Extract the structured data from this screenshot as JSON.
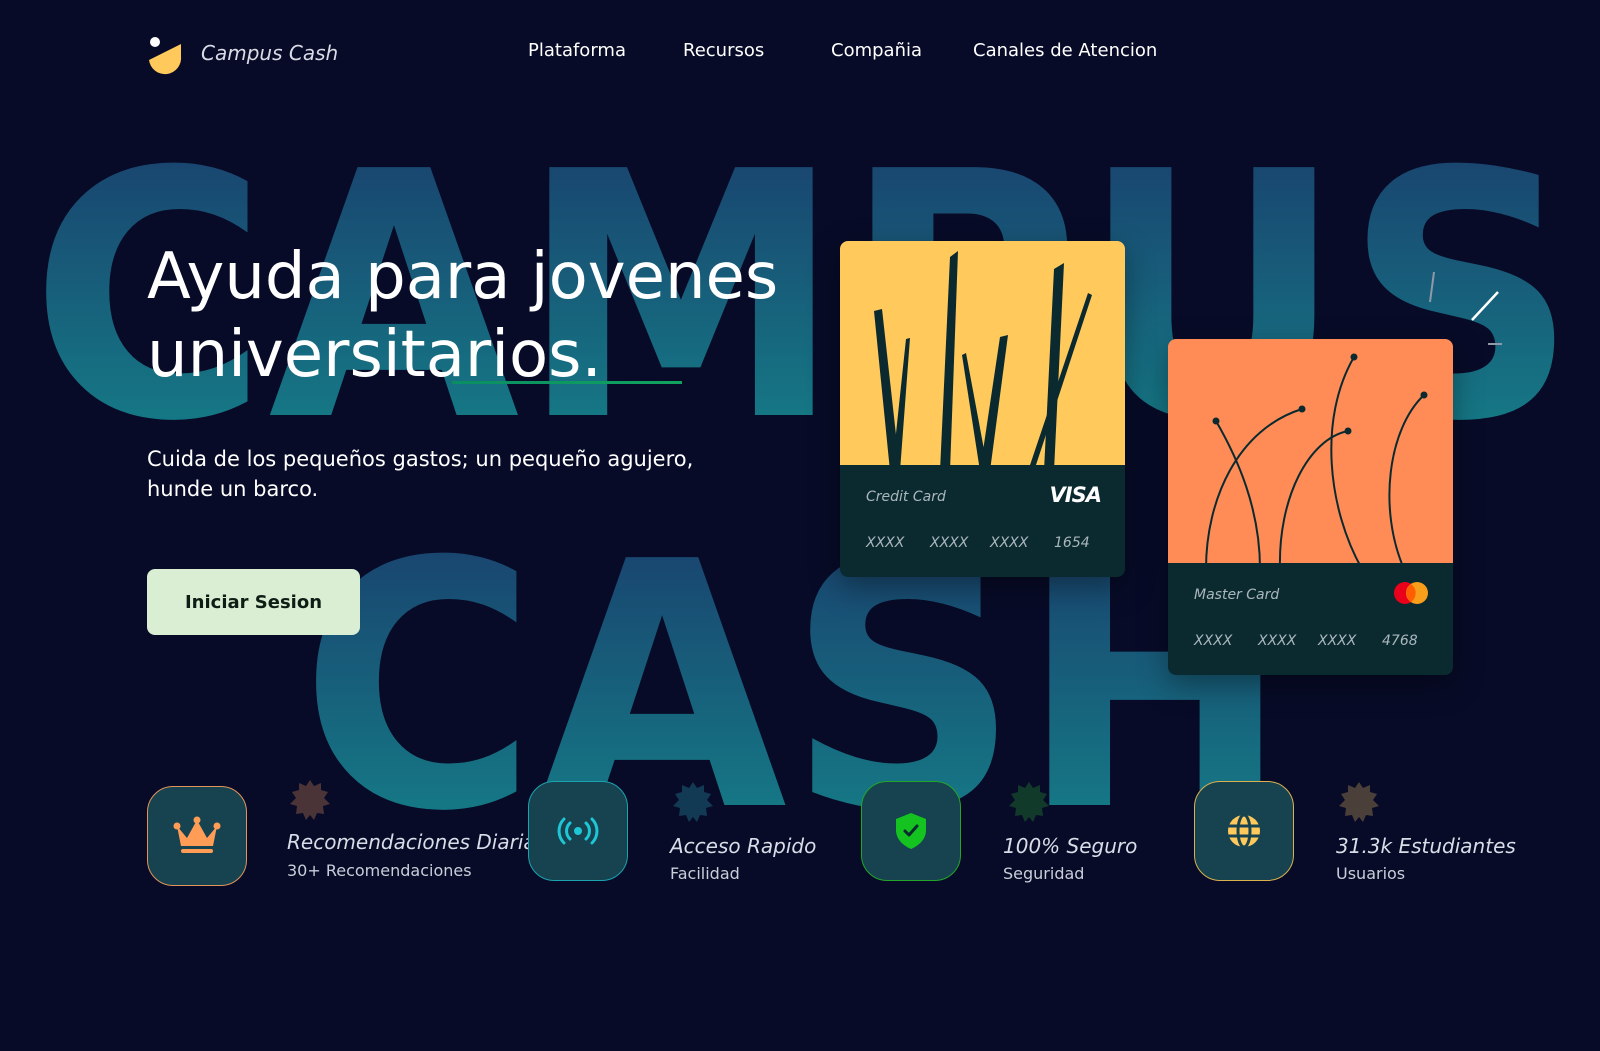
{
  "brand": {
    "name": "Campus Cash",
    "logo_color": "#ffc95b"
  },
  "nav": {
    "items": [
      {
        "label": "Plataforma"
      },
      {
        "label": "Recursos"
      },
      {
        "label": "Compañia"
      },
      {
        "label": "Canales de Atencion"
      }
    ]
  },
  "background_words": {
    "line1": "CAMPUS",
    "line2": "CASH",
    "gradient_top": "#1a3a6b",
    "gradient_bottom": "#14868b"
  },
  "hero": {
    "title_line1": "Ayuda para jovenes",
    "title_line2": "universitarios.",
    "subtitle_line1": "Cuida de los pequeños gastos; un pequeño agujero,",
    "subtitle_line2": "hunde un barco.",
    "cta_label": "Iniciar Sesion",
    "accent": "#0fa060"
  },
  "cards": [
    {
      "type": "Credit Card",
      "brand": "VISA",
      "numbers": [
        "XXXX",
        "XXXX",
        "XXXX",
        "1654"
      ],
      "art_color": "#ffc95b"
    },
    {
      "type": "Master Card",
      "brand": "mastercard-logo",
      "numbers": [
        "XXXX",
        "XXXX",
        "XXXX",
        "4768"
      ],
      "art_color": "#ff8c57"
    }
  ],
  "stats": [
    {
      "icon": "crown-icon",
      "title": "Recomendaciones Diarias",
      "subtitle": "30+ Recomendaciones",
      "border": "#e2945a",
      "badge": "#4b3437"
    },
    {
      "icon": "broadcast-icon",
      "title": "Acceso Rapido",
      "subtitle": "Facilidad",
      "border": "#1aa3b0",
      "badge": "#133a54"
    },
    {
      "icon": "shield-check-icon",
      "title": "100% Seguro",
      "subtitle": "Seguridad",
      "border": "#22a62a",
      "badge": "#123a2a"
    },
    {
      "icon": "globe-icon",
      "title": "31.3k Estudiantes",
      "subtitle": "Usuarios",
      "border": "#d9b24e",
      "badge": "#4b3f3a"
    }
  ]
}
